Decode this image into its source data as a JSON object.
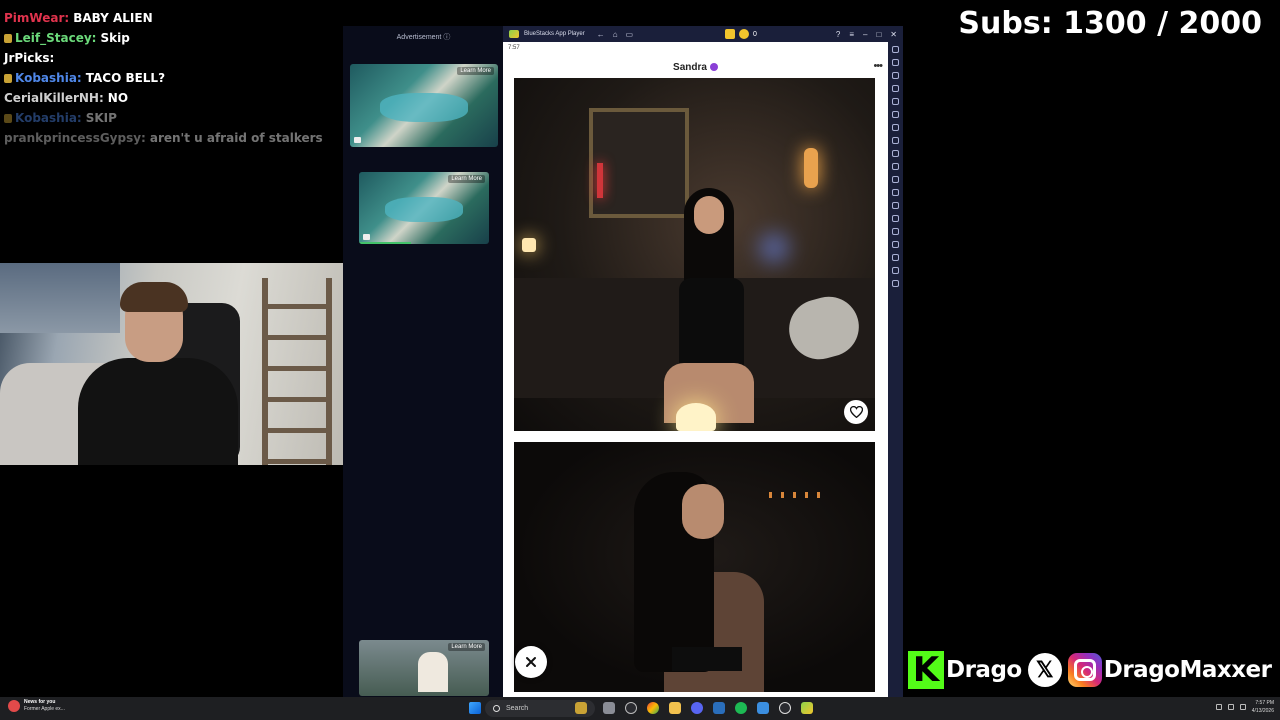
{
  "chat": {
    "messages": [
      {
        "user": "PimWear:",
        "text": "BABY ALIEN",
        "color": "#e0334d",
        "badge": false,
        "style": ""
      },
      {
        "user": "Leif_Stacey:",
        "text": "Skip",
        "color": "#6bd97a",
        "badge": true,
        "style": ""
      },
      {
        "user": "JrPicks:",
        "text": "",
        "color": "#ffffff",
        "badge": false,
        "style": ""
      },
      {
        "user": "Kobashia:",
        "text": "TACO BELL?",
        "color": "#4f87e8",
        "badge": true,
        "style": ""
      },
      {
        "user": "CerialKillerNH:",
        "text": "NO",
        "color": "#cfcfcf",
        "badge": false,
        "style": ""
      },
      {
        "user": "Kobashia:",
        "text": "SKIP",
        "color": "#4f87e8",
        "badge": true,
        "style": "fade"
      },
      {
        "user": "prankprincessGypsy:",
        "text": "aren't u afraid of stalkers",
        "color": "#cfcfcf",
        "badge": false,
        "style": "fade"
      },
      {
        "user": "",
        "text": "",
        "color": "#cfcfcf",
        "badge": false,
        "style": "faint"
      }
    ]
  },
  "ads": {
    "title": "Advertisement",
    "learn_more": "Learn More"
  },
  "emulator": {
    "window_title": "BlueStacks App Player",
    "coin_count": "0",
    "status_time": "7:57",
    "profile_name": "Sandra",
    "more_label": "•••",
    "like_icon": "heart-icon",
    "dismiss_icon": "close-icon",
    "colors": {
      "verified": "#8a3fd6",
      "titlebar": "#1a1f3a"
    }
  },
  "overlay": {
    "subs_text": "Subs: 1300 / 2000",
    "kick_letter": "K",
    "kick_name": "Drago",
    "x_glyph": "𝕏",
    "ig_name": "DragoMaxxer",
    "colors": {
      "kick": "#53fc18"
    }
  },
  "taskbar": {
    "news_title": "News for you",
    "news_sub": "Former Apple ex...",
    "search_placeholder": "Search",
    "clock_time": "7:57 PM",
    "clock_date": "4/13/2026"
  }
}
